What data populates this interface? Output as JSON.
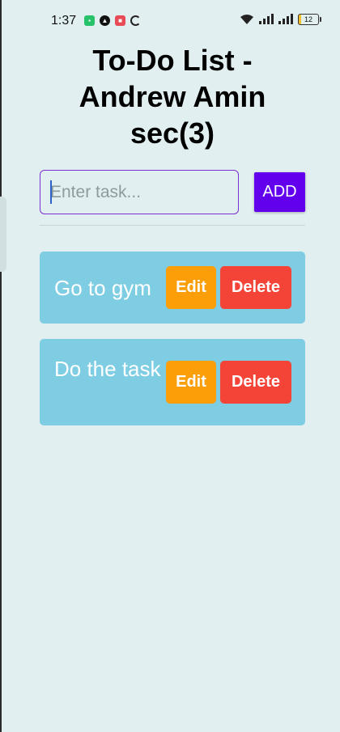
{
  "status_bar": {
    "time": "1:37",
    "battery_level": "12",
    "notification_icons": [
      "app-green-icon",
      "app-black-icon",
      "app-red-icon",
      "loading-ring-icon"
    ],
    "system_icons": [
      "wifi-icon",
      "signal-icon",
      "signal-icon",
      "battery-icon"
    ]
  },
  "header": {
    "title_lines": [
      "To-Do List -",
      "Andrew Amin",
      "sec(3)"
    ]
  },
  "task_input": {
    "value": "",
    "placeholder": "Enter task..."
  },
  "add_button": {
    "label": "ADD"
  },
  "tasks": [
    {
      "text": "Go to gym",
      "edit_label": "Edit",
      "delete_label": "Delete"
    },
    {
      "text": "Do the task",
      "edit_label": "Edit",
      "delete_label": "Delete"
    }
  ],
  "colors": {
    "background": "#e2eff0",
    "accent": "#6200ee",
    "card": "#7ecde3",
    "edit": "#fc9e07",
    "delete": "#f44437"
  }
}
